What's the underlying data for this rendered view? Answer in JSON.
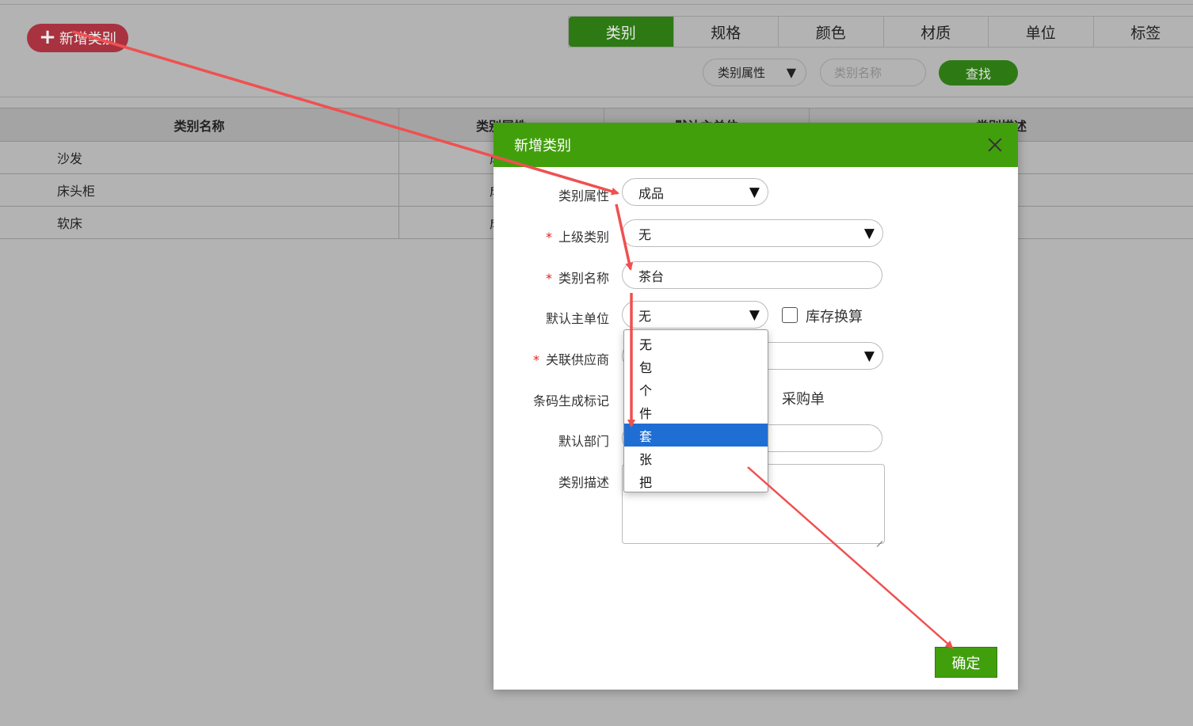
{
  "toolbar": {
    "add_label": "新增类别"
  },
  "tabs": [
    {
      "label": "类别",
      "active": true
    },
    {
      "label": "规格"
    },
    {
      "label": "颜色"
    },
    {
      "label": "材质"
    },
    {
      "label": "单位"
    },
    {
      "label": "标签"
    }
  ],
  "filter": {
    "attr_select": "类别属性",
    "name_placeholder": "类别名称",
    "find_label": "查找"
  },
  "table": {
    "headers": [
      "类别名称",
      "类别属性",
      "默认主单位",
      "类别描述"
    ],
    "rows": [
      {
        "name": "沙发",
        "attr": "成品"
      },
      {
        "name": "床头柜",
        "attr": "成品"
      },
      {
        "name": "软床",
        "attr": "成品"
      }
    ]
  },
  "modal": {
    "title": "新增类别",
    "fields": {
      "attr_label": "类别属性",
      "attr_value": "成品",
      "parent_label": "上级类别",
      "parent_value": "无",
      "name_label": "类别名称",
      "name_value": "茶台",
      "unit_label": "默认主单位",
      "unit_value": "无",
      "stock_convert_label": "库存换算",
      "supplier_label": "关联供应商",
      "barcode_label": "条码生成标记",
      "barcode_option": "采购单",
      "dept_label": "默认部门",
      "desc_label": "类别描述"
    },
    "required_mark": "*",
    "unit_options": [
      "无",
      "包",
      "个",
      "件",
      "套",
      "张",
      "把"
    ],
    "unit_selected_index": 4,
    "ok_label": "确定"
  },
  "colors": {
    "primary_green": "#419f0c",
    "accent_red": "#a8323f",
    "annotation_arrow": "#f05050",
    "selected_option": "#1f6ed4"
  }
}
